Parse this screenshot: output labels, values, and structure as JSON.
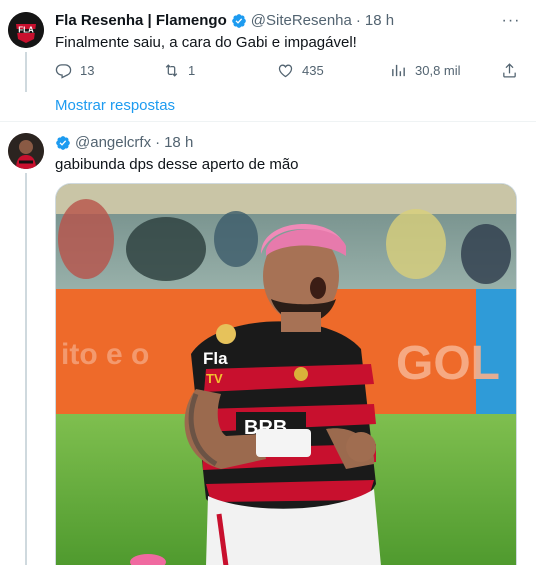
{
  "tweet1": {
    "display_name": "Fla Resenha | Flamengo",
    "handle": "@SiteResenha",
    "separator": "·",
    "time": "18 h",
    "text": "Finalmente saiu, a cara do Gabi e impagável!",
    "avatar_text": "FLA",
    "actions": {
      "replies": "13",
      "retweets": "1",
      "likes": "435",
      "views": "30,8 mil"
    },
    "show_replies": "Mostrar respostas"
  },
  "tweet2": {
    "handle": "@angelcrfx",
    "separator": "·",
    "time": "18 h",
    "text": "gabibunda dps desse aperto de mão",
    "media": {
      "board_text": "GOL",
      "shirt_text": "BRB",
      "sleeve_text": "Fla",
      "sleeve_text2": "TV"
    }
  },
  "colors": {
    "accent": "#1d9bf0",
    "muted": "#536471",
    "flamengo_red": "#c8102e"
  },
  "icons": [
    "verified-badge-icon",
    "more-icon",
    "reply-icon",
    "retweet-icon",
    "like-icon",
    "views-icon",
    "share-icon"
  ]
}
